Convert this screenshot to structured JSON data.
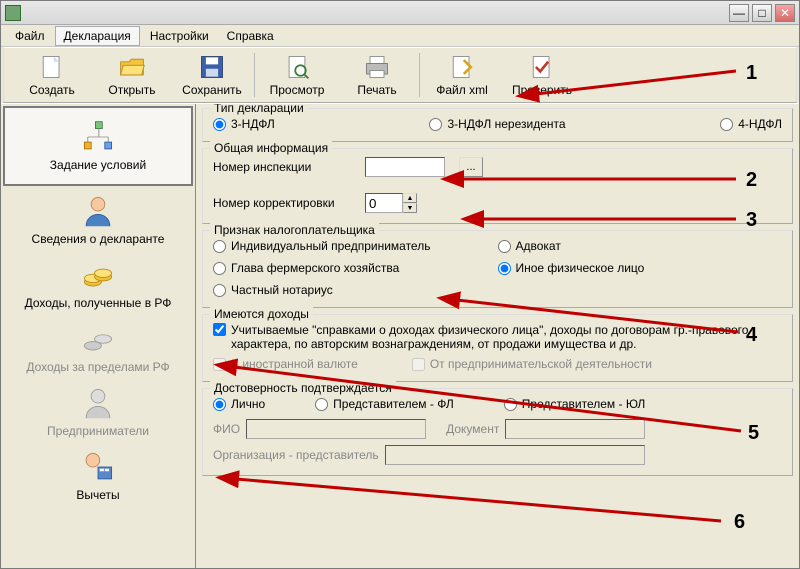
{
  "title": "",
  "menus": [
    "Файл",
    "Декларация",
    "Настройки",
    "Справка"
  ],
  "toolbar": [
    {
      "label": "Создать",
      "icon": "new"
    },
    {
      "label": "Открыть",
      "icon": "open"
    },
    {
      "label": "Сохранить",
      "icon": "save"
    },
    {
      "label": "Просмотр",
      "icon": "preview"
    },
    {
      "label": "Печать",
      "icon": "print"
    },
    {
      "label": "Файл xml",
      "icon": "xml"
    },
    {
      "label": "Проверить",
      "icon": "check"
    }
  ],
  "sidebar": [
    {
      "label": "Задание условий",
      "selected": true
    },
    {
      "label": "Сведения о декларанте"
    },
    {
      "label": "Доходы, полученные в РФ"
    },
    {
      "label": "Доходы за пределами РФ",
      "disabled": true
    },
    {
      "label": "Предприниматели",
      "disabled": true
    },
    {
      "label": "Вычеты"
    }
  ],
  "decl_type": {
    "legend": "Тип декларации",
    "opts": [
      "3-НДФЛ",
      "3-НДФЛ нерезидента",
      "4-НДФЛ"
    ],
    "selected": 0
  },
  "general": {
    "legend": "Общая информация",
    "inspection_label": "Номер инспекции",
    "inspection_value": "",
    "browse": "...",
    "correction_label": "Номер корректировки",
    "correction_value": "0"
  },
  "taxpayer": {
    "legend": "Признак налогоплательщика",
    "opts": [
      "Индивидуальный предприниматель",
      "Глава фермерского хозяйства",
      "Частный нотариус",
      "Адвокат",
      "Иное физическое лицо"
    ],
    "selected": 4
  },
  "income": {
    "legend": "Имеются доходы",
    "opt1": "Учитываемые \"справками о доходах физического лица\", доходы по договорам гр.-правового характера, по авторским вознаграждениям, от продажи имущества и др.",
    "opt2": "В иностранной валюте",
    "opt3": "От предпринимательской деятельности"
  },
  "auth": {
    "legend": "Достоверность подтверждается",
    "opts": [
      "Лично",
      "Представителем - ФЛ",
      "Представителем - ЮЛ"
    ],
    "selected": 0,
    "fio_placeholder": "ФИО",
    "doc_placeholder": "Документ",
    "org_placeholder": "Организация - представитель"
  },
  "annotations": [
    "1",
    "2",
    "3",
    "4",
    "5",
    "6"
  ]
}
